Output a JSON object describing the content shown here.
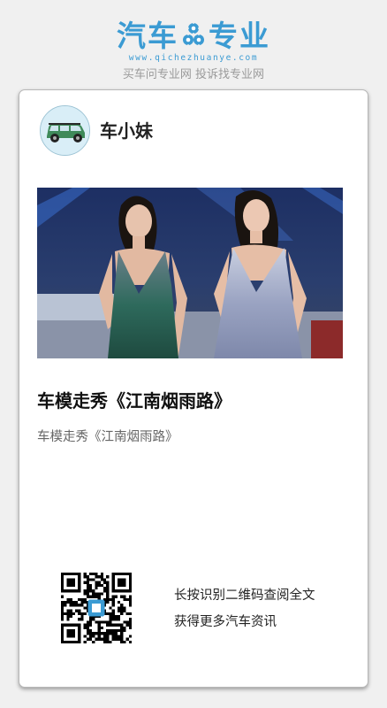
{
  "header": {
    "logo_part1": "汽车",
    "logo_part2": "专业",
    "logo_url": "www.qichezhuanye.com",
    "slogan": "买车问专业网 投诉找专业网",
    "brand_color": "#3b9bd3"
  },
  "card": {
    "author_name": "车小妹",
    "avatar_icon": "car-avatar-icon",
    "photo_description_icon": "article-cover-photo",
    "title": "车模走秀《江南烟雨路》",
    "description": "车模走秀《江南烟雨路》",
    "qr_icon": "qr-code-icon",
    "qr_line1": "长按识别二维码查阅全文",
    "qr_line2": "获得更多汽车资讯"
  }
}
